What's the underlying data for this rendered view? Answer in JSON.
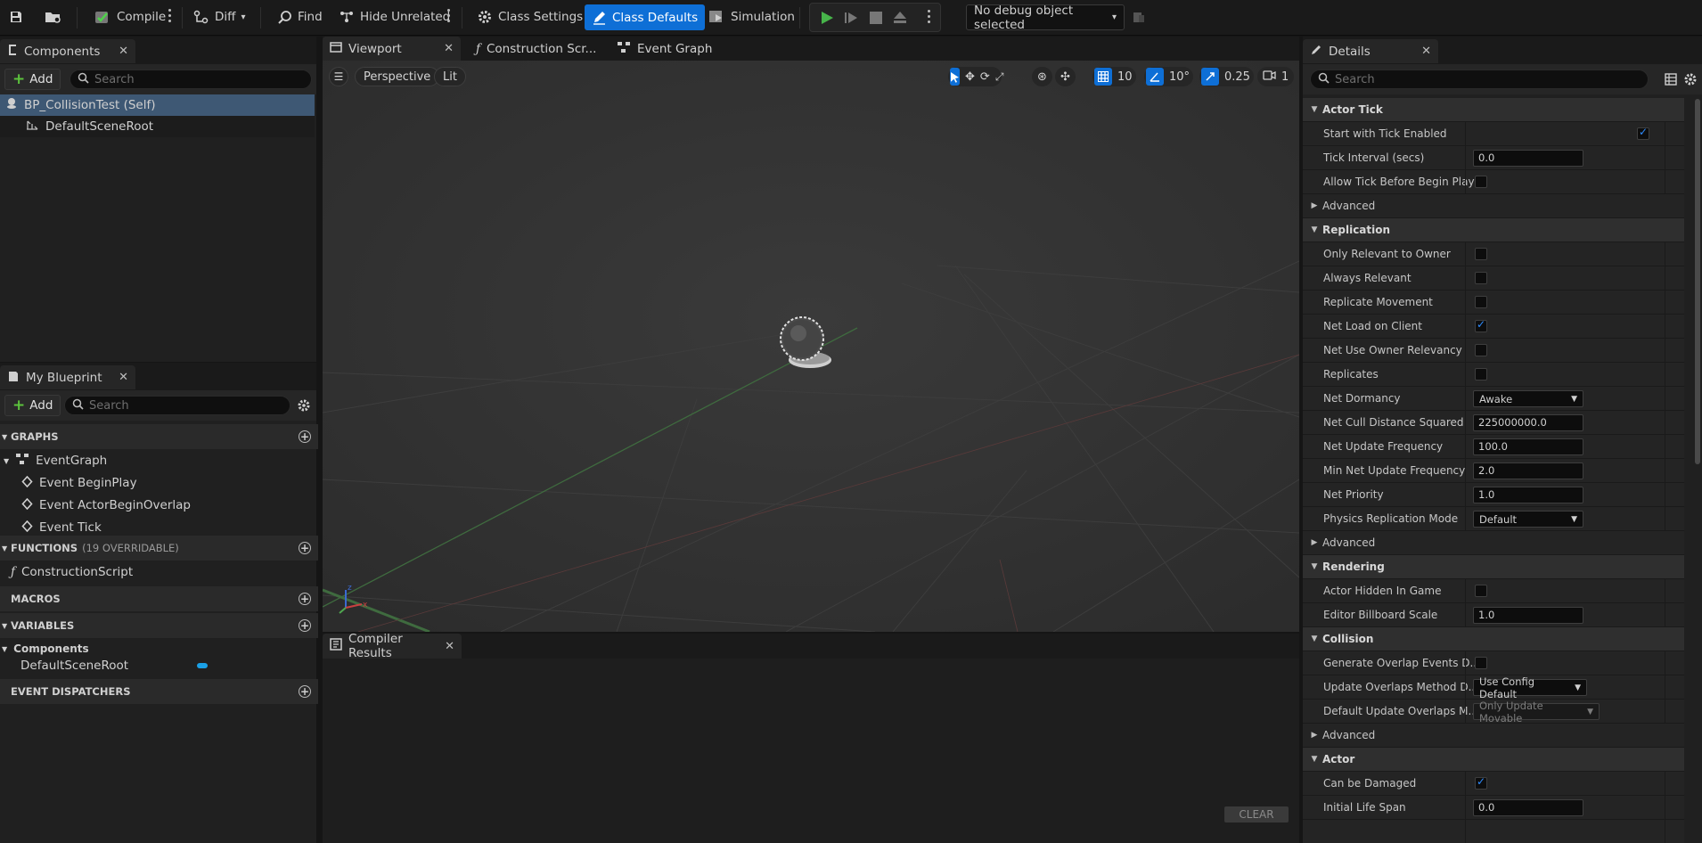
{
  "toolbar": {
    "compile": "Compile",
    "diff": "Diff",
    "find": "Find",
    "hide_unrelated": "Hide Unrelated",
    "class_settings": "Class Settings",
    "class_defaults": "Class Defaults",
    "simulation": "Simulation",
    "debug_object": "No debug object selected"
  },
  "components": {
    "tab": "Components",
    "add": "Add",
    "search_placeholder": "Search",
    "tree": [
      "BP_CollisionTest (Self)",
      "DefaultSceneRoot"
    ]
  },
  "my_blueprint": {
    "tab": "My Blueprint",
    "add": "Add",
    "search_placeholder": "Search",
    "graphs_header": "GRAPHS",
    "event_graph": "EventGraph",
    "events": [
      "Event BeginPlay",
      "Event ActorBeginOverlap",
      "Event Tick"
    ],
    "functions_header": "FUNCTIONS",
    "functions_count": "(19 OVERRIDABLE)",
    "construction_script": "ConstructionScript",
    "macros_header": "MACROS",
    "variables_header": "VARIABLES",
    "components_group": "Components",
    "default_scene_root": "DefaultSceneRoot",
    "event_dispatchers_header": "EVENT DISPATCHERS",
    "accent": "#1aa0e6"
  },
  "editor_tabs": {
    "viewport": "Viewport",
    "construction": "Construction Scr...",
    "event_graph": "Event Graph"
  },
  "viewport": {
    "perspective": "Perspective",
    "lit": "Lit",
    "grid_snap": "10",
    "rotation_snap": "10°",
    "scale_snap": "0.25",
    "camera_speed": "1"
  },
  "compiler": {
    "tab": "Compiler Results",
    "clear": "CLEAR"
  },
  "details": {
    "tab": "Details",
    "search_placeholder": "Search",
    "advanced": "Advanced",
    "actor_tick": {
      "title": "Actor Tick",
      "start_with_tick": "Start with Tick Enabled",
      "tick_interval": "Tick Interval (secs)",
      "tick_interval_value": "0.0",
      "allow_tick_before": "Allow Tick Before Begin Play"
    },
    "replication": {
      "title": "Replication",
      "only_relevant": "Only Relevant to Owner",
      "always_relevant": "Always Relevant",
      "replicate_movement": "Replicate Movement",
      "net_load": "Net Load on Client",
      "net_use_owner": "Net Use Owner Relevancy",
      "replicates": "Replicates",
      "net_dormancy": "Net Dormancy",
      "net_dormancy_value": "Awake",
      "net_cull": "Net Cull Distance Squared",
      "net_cull_value": "225000000.0",
      "net_update": "Net Update Frequency",
      "net_update_value": "100.0",
      "min_net_update": "Min Net Update Frequency",
      "min_net_update_value": "2.0",
      "net_priority": "Net Priority",
      "net_priority_value": "1.0",
      "physics_mode": "Physics Replication Mode",
      "physics_mode_value": "Default"
    },
    "rendering": {
      "title": "Rendering",
      "hidden_in_game": "Actor Hidden In Game",
      "billboard_scale": "Editor Billboard Scale",
      "billboard_scale_value": "1.0"
    },
    "collision": {
      "title": "Collision",
      "generate_overlap": "Generate Overlap Events D...",
      "update_overlaps": "Update Overlaps Method D...",
      "update_overlaps_value": "Use Config Default",
      "default_update": "Default Update Overlaps M...",
      "default_update_value": "Only Update Movable"
    },
    "actor": {
      "title": "Actor",
      "can_be_damaged": "Can be Damaged",
      "initial_life_span": "Initial Life Span",
      "initial_life_span_value": "0.0"
    }
  }
}
